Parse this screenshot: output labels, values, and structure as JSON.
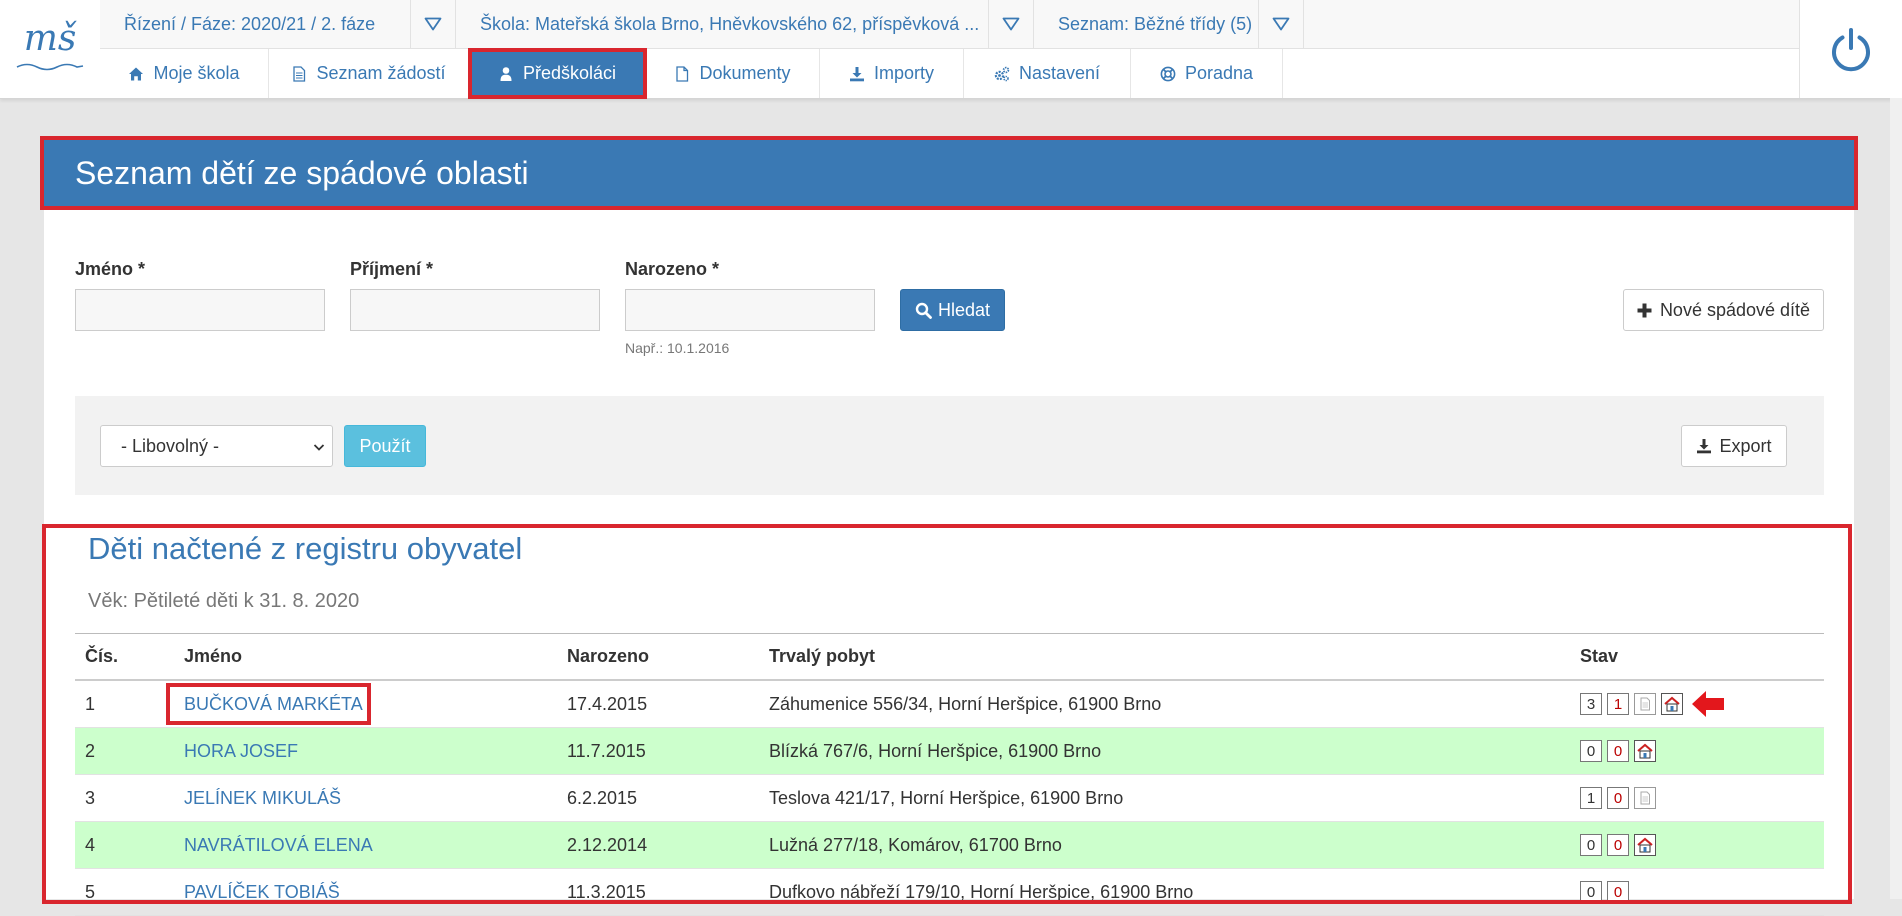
{
  "app": {
    "logo_text": "mš"
  },
  "selectors": {
    "rizeni": "Řízení / Fáze: 2020/21 / 2. fáze",
    "skola": "Škola: Mateřská škola Brno, Hněvkovského 62, příspěvková ...",
    "seznam": "Seznam: Běžné třídy (5)"
  },
  "nav": {
    "tabs": [
      {
        "label": "Moje škola",
        "icon": "home-icon"
      },
      {
        "label": "Seznam žádostí",
        "icon": "file-text-icon"
      },
      {
        "label": "Předškoláci",
        "icon": "user-icon",
        "active": true
      },
      {
        "label": "Dokumenty",
        "icon": "file-icon"
      },
      {
        "label": "Importy",
        "icon": "download-icon"
      },
      {
        "label": "Nastavení",
        "icon": "gears-icon"
      },
      {
        "label": "Poradna",
        "icon": "lifebuoy-icon"
      }
    ]
  },
  "panel": {
    "title": "Seznam dětí ze spádové oblasti"
  },
  "search": {
    "jmeno_label": "Jméno *",
    "prijmeni_label": "Příjmení *",
    "narozeno_label": "Narozeno *",
    "jmeno_value": "",
    "prijmeni_value": "",
    "narozeno_value": "",
    "narozeno_hint": "Např.: 10.1.2016",
    "search_label": "Hledat",
    "new_label": "Nové spádové dítě"
  },
  "filter": {
    "select_value": "- Libovolný -",
    "apply_label": "Použít",
    "export_label": "Export"
  },
  "results": {
    "title": "Děti načtené z registru obyvatel",
    "subtitle": "Věk: Pětileté děti k 31. 8. 2020",
    "columns": {
      "num": "Čís.",
      "name": "Jméno",
      "born": "Narozeno",
      "address": "Trvalý pobyt",
      "status": "Stav"
    },
    "rows": [
      {
        "num": "1",
        "name": "BUČKOVÁ MARKÉTA",
        "born": "17.4.2015",
        "address": "Záhumenice 556/34, Horní Heršpice, 61900 Brno",
        "s1": "3",
        "s2": "1",
        "doc": true,
        "house": true
      },
      {
        "num": "2",
        "name": "HORA JOSEF",
        "born": "11.7.2015",
        "address": "Blízká 767/6, Horní Heršpice, 61900 Brno",
        "s1": "0",
        "s2": "0",
        "doc": false,
        "house": true
      },
      {
        "num": "3",
        "name": "JELÍNEK MIKULÁŠ",
        "born": "6.2.2015",
        "address": "Teslova 421/17, Horní Heršpice, 61900 Brno",
        "s1": "1",
        "s2": "0",
        "doc": true,
        "house": false
      },
      {
        "num": "4",
        "name": "NAVRÁTILOVÁ ELENA",
        "born": "2.12.2014",
        "address": "Lužná 277/18, Komárov, 61700 Brno",
        "s1": "0",
        "s2": "0",
        "doc": false,
        "house": true
      },
      {
        "num": "5",
        "name": "PAVLÍČEK TOBIÁŠ",
        "born": "11.3.2015",
        "address": "Dufkovo nábřeží 179/10, Horní Heršpice, 61900 Brno",
        "s1": "0",
        "s2": "0",
        "doc": false,
        "house": false
      }
    ]
  },
  "colors": {
    "primary": "#3a79b4",
    "highlight": "#d9262e",
    "row_green": "#ccffcc",
    "info": "#5bc0de"
  }
}
